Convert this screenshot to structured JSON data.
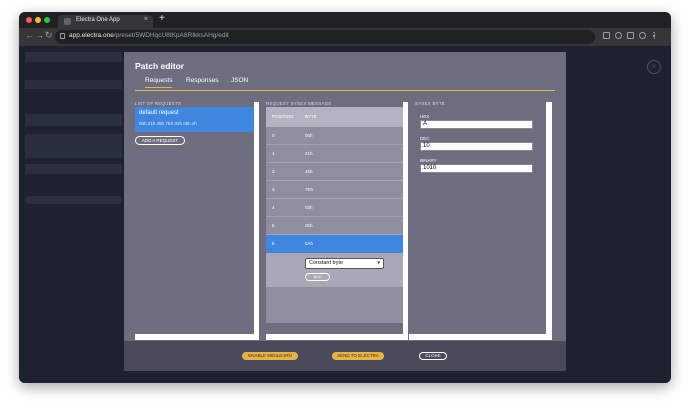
{
  "browser": {
    "tab_title": "Electra One App",
    "tab_close": "×",
    "new_tab": "+",
    "url_host": "app.electra.one",
    "url_path": "/preset/5WDHqcU8tKpA8RIkksAHg/edit",
    "back": "←",
    "forward": "→",
    "reload": "↻"
  },
  "modal": {
    "title": "Patch editor",
    "tabs": [
      "Requests",
      "Responses",
      "JSON"
    ],
    "requests_label": "LIST OF REQUESTS",
    "request_name": "default request",
    "request_bytes": "00h 21h 45h 7Eh 02h 05h xh",
    "add_request": "ADD A REQUEST",
    "sysex_label": "REQUEST SYSEX MESSAGE",
    "sysex_headers": {
      "position": "POSITION",
      "byte": "BYTE"
    },
    "sysex_rows": [
      {
        "position": "0",
        "byte": "00h"
      },
      {
        "position": "1",
        "byte": "21h"
      },
      {
        "position": "2",
        "byte": "45h"
      },
      {
        "position": "3",
        "byte": "7Eh"
      },
      {
        "position": "4",
        "byte": "02h"
      },
      {
        "position": "5",
        "byte": "05h"
      },
      {
        "position": "6",
        "byte": "0Ah"
      }
    ],
    "selected_row": 6,
    "byte_type": "Constant byte",
    "add_byte": "ADD",
    "byte_label": "SYSEX BYTE",
    "hex_label": "HEX",
    "hex_value": "A",
    "dec_label": "DEC",
    "dec_value": "10",
    "bin_label": "BINARY",
    "bin_value": "1010",
    "footer": {
      "midilearn": "ENABLE MIDILEARN",
      "send": "SEND TO ELECTRA",
      "close": "CLOSE"
    }
  },
  "colors": {
    "accent": "#e8b247",
    "selection": "#3e86e0",
    "modal_bg": "#6e6d80"
  }
}
